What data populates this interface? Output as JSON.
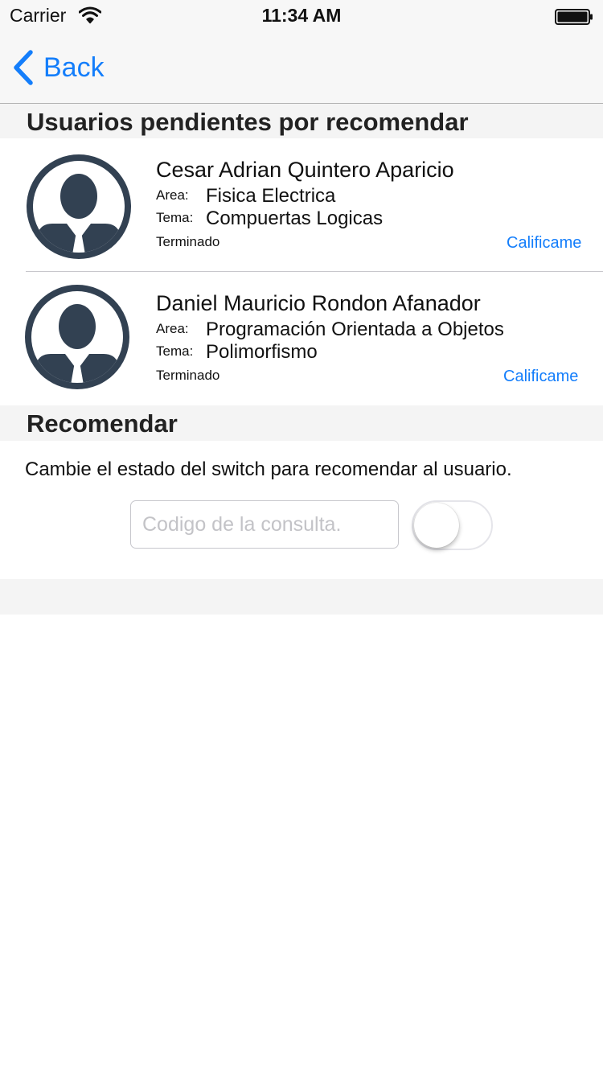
{
  "status_bar": {
    "carrier": "Carrier",
    "time": "11:34 AM"
  },
  "nav": {
    "back_label": "Back"
  },
  "colors": {
    "accent": "#147efb",
    "avatar": "#324152",
    "section_background": "#f4f4f4"
  },
  "pending_section": {
    "title": "Usuarios pendientes por recomendar",
    "users": [
      {
        "name": "Cesar Adrian Quintero Aparicio",
        "area_label": "Area:",
        "area": "Fisica Electrica",
        "tema_label": "Tema:",
        "tema": "Compuertas Logicas",
        "status": "Terminado",
        "action_label": "Calificame"
      },
      {
        "name": "Daniel Mauricio Rondon Afanador",
        "area_label": "Area:",
        "area": "Programación Orientada a Objetos",
        "tema_label": "Tema:",
        "tema": "Polimorfismo",
        "status": "Terminado",
        "action_label": "Calificame"
      }
    ]
  },
  "recommend_section": {
    "title": "Recomendar",
    "instruction": "Cambie el estado del switch para recomendar al usuario.",
    "code_placeholder": "Codigo de la consulta.",
    "code_value": "",
    "switch_on": false
  }
}
